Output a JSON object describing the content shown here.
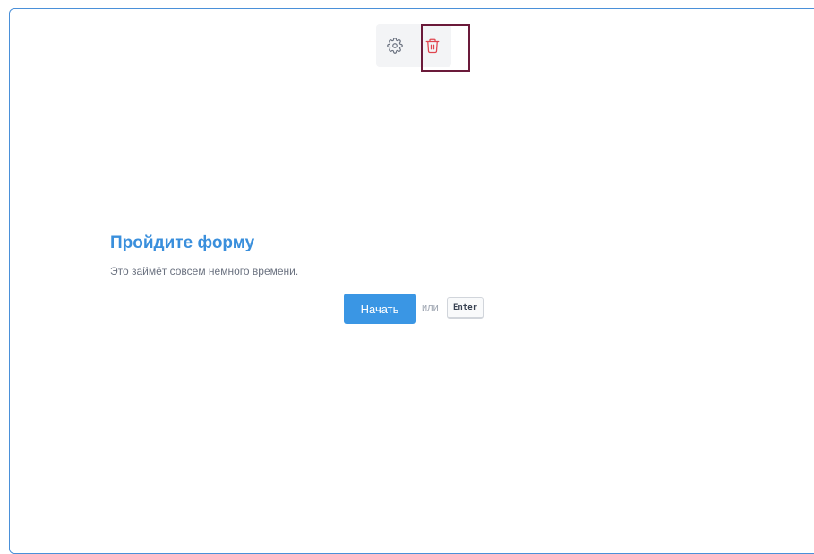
{
  "toolbar": {
    "settings_icon": "gear-icon",
    "delete_icon": "trash-icon",
    "delete_color": "#e0454f",
    "settings_color": "#6b7280"
  },
  "form": {
    "title": "Пройдите форму",
    "subtitle": "Это займёт совсем немного времени.",
    "start_button_label": "Начать",
    "or_text": "или",
    "key_hint": "Enter",
    "accent_color": "#3a96e4"
  }
}
